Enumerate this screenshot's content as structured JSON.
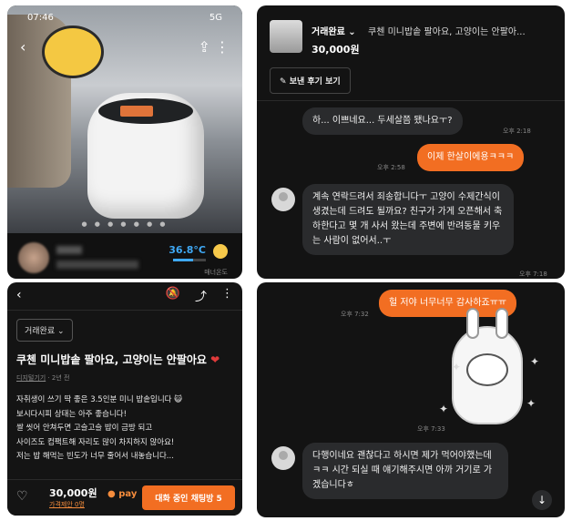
{
  "listing_photo": {
    "time": "07:46",
    "signal": "5G",
    "page_indicator": "● ● ● ● ● ● ●"
  },
  "seller": {
    "temperature": "36.8°C",
    "manner_label": "매너온도"
  },
  "listing": {
    "status": "거래완료",
    "title": "쿠첸 미니밥솥 팔아요, 고양이는 안팔아요",
    "category": "디지털기기",
    "posted": "2년 전",
    "description": [
      "자취생이 쓰기 딱 좋은 3.5인분 미니 밥솥입니다 😺",
      "보시다시피 상태는 아주 좋습니다!",
      "쌀 씻어 안쳐두면 고슬고슬 밥이 금방 되고",
      "사이즈도 컴팩트해 자리도 많이 차지하지 않아요!",
      "저는 밥 해먹는 빈도가 너무 줄어서 내놓습니다..."
    ],
    "price": "30,000원",
    "offer_label": "가격제안 0명",
    "pay_label": "pay",
    "chat_button": "대화 중인 채팅방 5"
  },
  "chat_header": {
    "status": "거래완료",
    "title": "쿠첸 미니밥솥 팔아요, 고양이는 안팔아...",
    "price": "30,000원",
    "review_button": "보낸 후기 보기"
  },
  "messages": [
    {
      "text": "하... 이쁘네요... 두세살쯤 됐나요ㅜ?",
      "time": "오후 2:18"
    },
    {
      "text": "이제 한살이에용ㅋㅋㅋ",
      "time": "오후 2:58"
    },
    {
      "text": "계속 연락드려서 죄송합니다ㅜ 고양이 수제간식이 생겼는데 드려도 될까요? 친구가 가게 오픈해서 축하한다고 몇 개 사서 왔는데 주변에 반려동물 키우는 사람이 없어서..ㅜ",
      "time": "오후 7:18"
    },
    {
      "text": "헐 저야 너무너무 감사하죠ㅠㅠ",
      "time": "오후 7:32"
    },
    {
      "text": "",
      "time": "오후 7:33"
    },
    {
      "text": "다행이네요 괜찮다고 하시면 제가 먹어야했는데ㅋㅋ 시간 되실 때 얘기해주시면 아까 거기로 가겠습니다ㅎ",
      "time": ""
    }
  ],
  "colors": {
    "accent": "#f26e22",
    "temperature": "#3fa9f5",
    "panel_bg": "#131313"
  }
}
